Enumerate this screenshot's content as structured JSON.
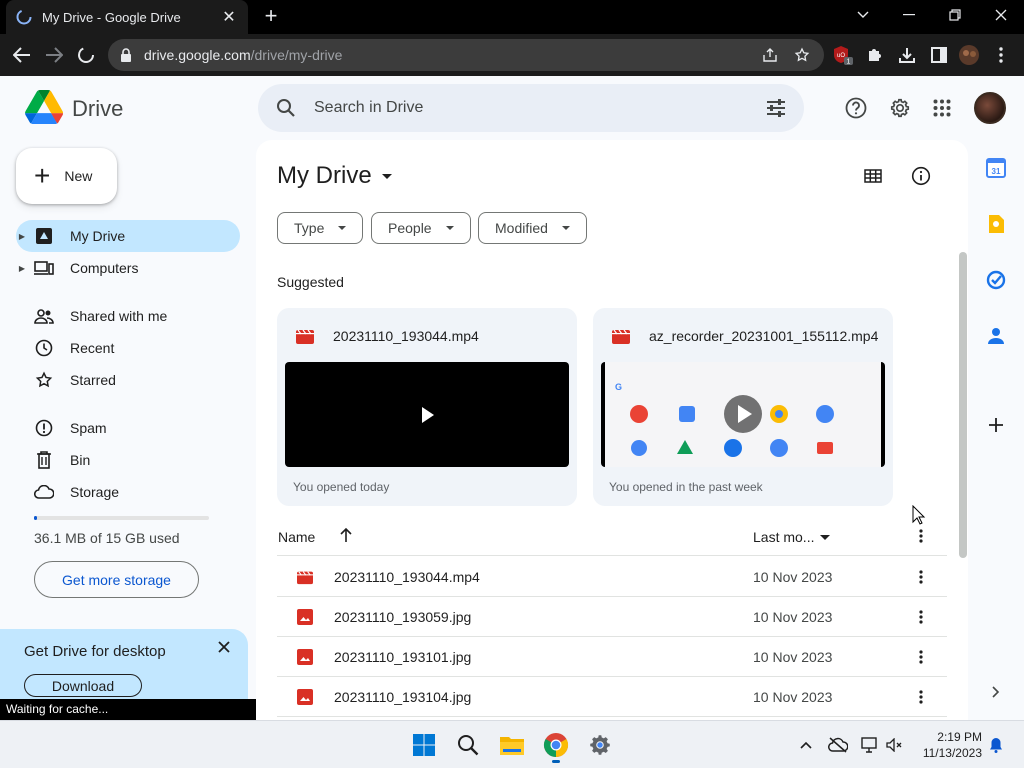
{
  "browser": {
    "tab_title": "My Drive - Google Drive",
    "tab_close": "✕",
    "new_tab": "+",
    "url_host": "drive.google.com",
    "url_path": "/drive/my-drive",
    "extension_badge": "1"
  },
  "drive": {
    "brand": "Drive",
    "search_placeholder": "Search in Drive"
  },
  "sidebar": {
    "new_label": "New",
    "items": [
      {
        "label": "My Drive",
        "icon": "my-drive-icon",
        "active": true
      },
      {
        "label": "Computers",
        "icon": "computers-icon"
      },
      {
        "label": "Shared with me",
        "icon": "shared-icon"
      },
      {
        "label": "Recent",
        "icon": "clock-icon"
      },
      {
        "label": "Starred",
        "icon": "star-icon"
      },
      {
        "label": "Spam",
        "icon": "spam-icon"
      },
      {
        "label": "Bin",
        "icon": "bin-icon"
      },
      {
        "label": "Storage",
        "icon": "cloud-icon"
      }
    ],
    "storage_used_fraction": 0.0024,
    "storage_text": "36.1 MB of 15 GB used",
    "get_more_storage": "Get more storage",
    "promo_title": "Get Drive for desktop",
    "promo_button": "Download"
  },
  "status_text": "Waiting for cache...",
  "main": {
    "title": "My Drive",
    "filters": [
      "Type",
      "People",
      "Modified"
    ],
    "suggested_label": "Suggested",
    "suggested": [
      {
        "name": "20231110_193044.mp4",
        "meta": "You opened today"
      },
      {
        "name": "az_recorder_20231001_155112.mp4",
        "meta": "You opened in the past week"
      }
    ],
    "columns": {
      "name": "Name",
      "modified": "Last mo..."
    },
    "files": [
      {
        "name": "20231110_193044.mp4",
        "date": "10 Nov 2023",
        "type": "video"
      },
      {
        "name": "20231110_193059.jpg",
        "date": "10 Nov 2023",
        "type": "image"
      },
      {
        "name": "20231110_193101.jpg",
        "date": "10 Nov 2023",
        "type": "image"
      },
      {
        "name": "20231110_193104.jpg",
        "date": "10 Nov 2023",
        "type": "image"
      }
    ]
  },
  "side_panel": {
    "calendar_day": "31"
  },
  "taskbar": {
    "time": "2:19 PM",
    "date": "11/13/2023"
  },
  "colors": {
    "accent": "#0b57d0",
    "active_nav": "#c2e7ff",
    "file_red": "#d93025"
  }
}
